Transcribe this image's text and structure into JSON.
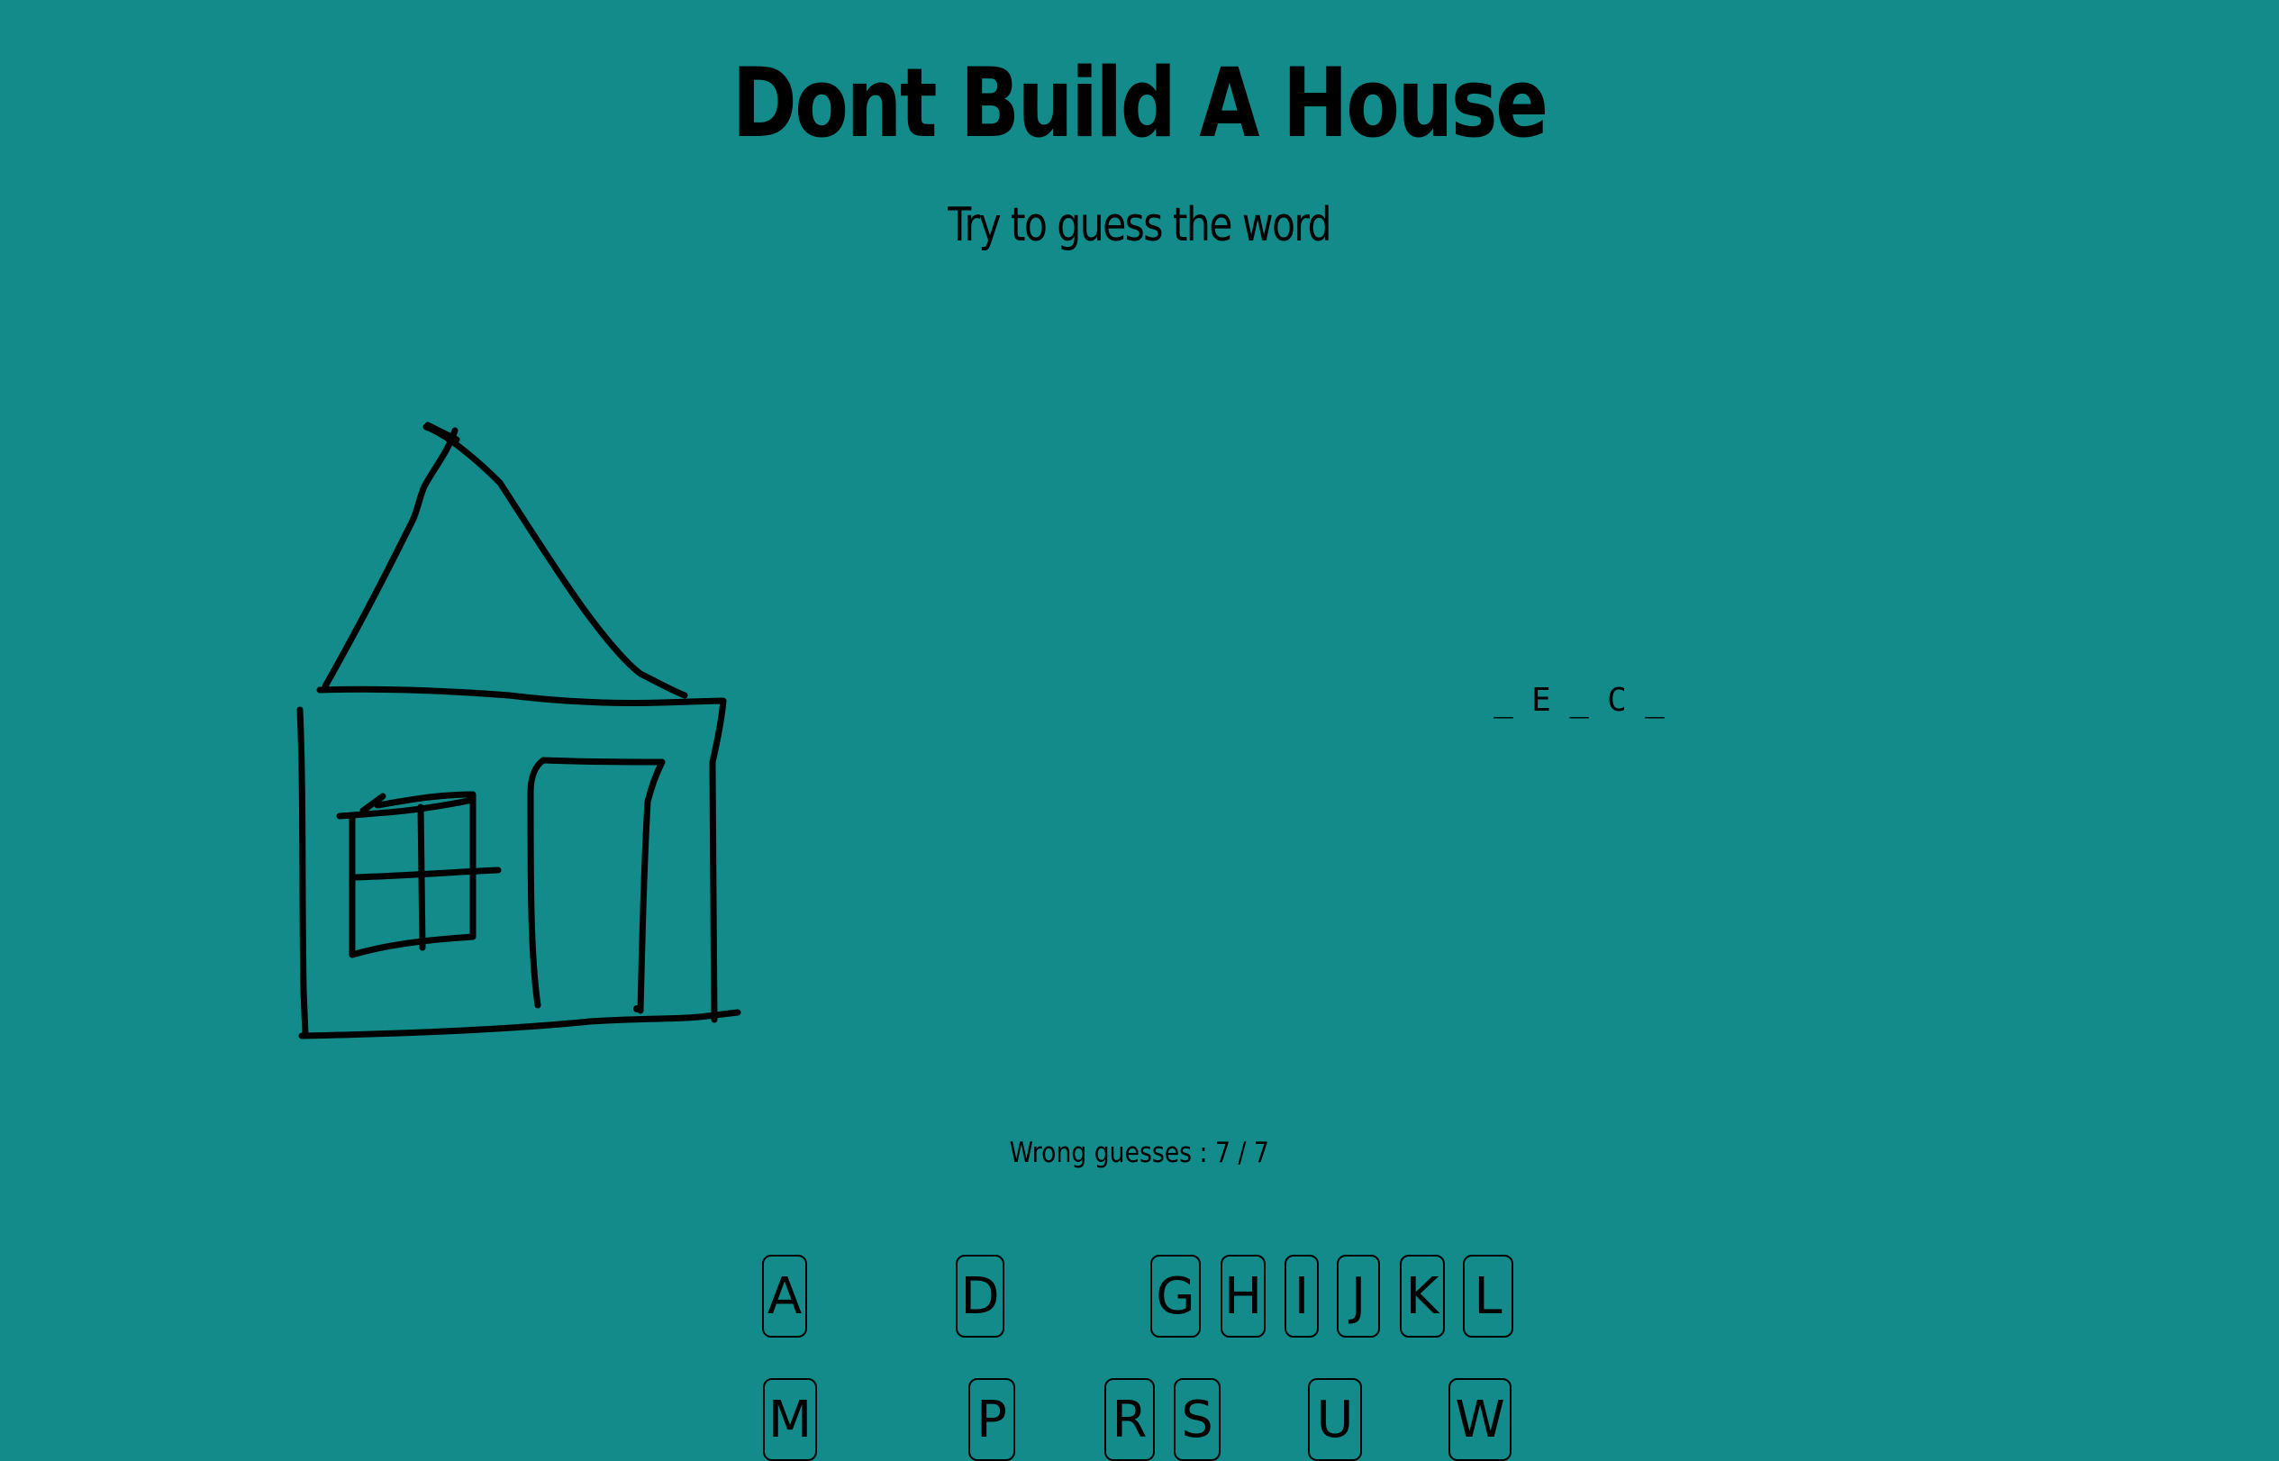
{
  "header": {
    "title": "Dont Build A House",
    "subtitle": "Try to guess the word"
  },
  "word": {
    "slots": [
      "_",
      "E",
      "_",
      "C",
      "_"
    ]
  },
  "status": {
    "wrong_guesses": "Wrong guesses : 7 / 7"
  },
  "keyboard": {
    "row1": [
      "A",
      "D",
      "G",
      "H",
      "I",
      "J",
      "K",
      "L"
    ],
    "row2": [
      "M",
      "P",
      "R",
      "S",
      "U",
      "W"
    ]
  },
  "colors": {
    "background": "#138b8b",
    "ink": "#000000"
  }
}
